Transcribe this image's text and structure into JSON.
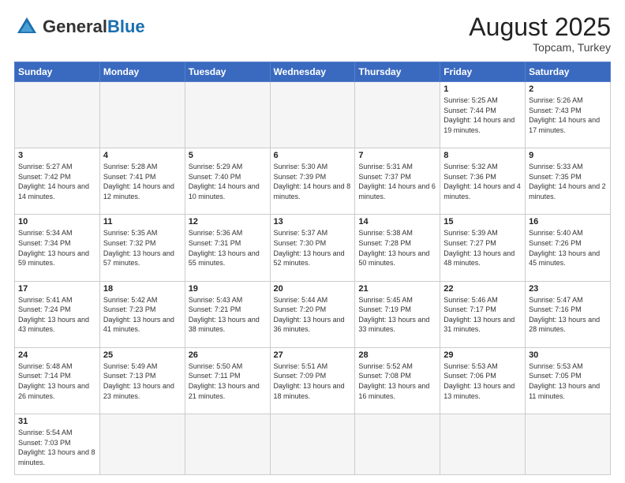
{
  "header": {
    "logo_general": "General",
    "logo_blue": "Blue",
    "title": "August 2025",
    "location": "Topcam, Turkey"
  },
  "weekdays": [
    "Sunday",
    "Monday",
    "Tuesday",
    "Wednesday",
    "Thursday",
    "Friday",
    "Saturday"
  ],
  "weeks": [
    [
      {
        "day": "",
        "info": ""
      },
      {
        "day": "",
        "info": ""
      },
      {
        "day": "",
        "info": ""
      },
      {
        "day": "",
        "info": ""
      },
      {
        "day": "",
        "info": ""
      },
      {
        "day": "1",
        "info": "Sunrise: 5:25 AM\nSunset: 7:44 PM\nDaylight: 14 hours and 19 minutes."
      },
      {
        "day": "2",
        "info": "Sunrise: 5:26 AM\nSunset: 7:43 PM\nDaylight: 14 hours and 17 minutes."
      }
    ],
    [
      {
        "day": "3",
        "info": "Sunrise: 5:27 AM\nSunset: 7:42 PM\nDaylight: 14 hours and 14 minutes."
      },
      {
        "day": "4",
        "info": "Sunrise: 5:28 AM\nSunset: 7:41 PM\nDaylight: 14 hours and 12 minutes."
      },
      {
        "day": "5",
        "info": "Sunrise: 5:29 AM\nSunset: 7:40 PM\nDaylight: 14 hours and 10 minutes."
      },
      {
        "day": "6",
        "info": "Sunrise: 5:30 AM\nSunset: 7:39 PM\nDaylight: 14 hours and 8 minutes."
      },
      {
        "day": "7",
        "info": "Sunrise: 5:31 AM\nSunset: 7:37 PM\nDaylight: 14 hours and 6 minutes."
      },
      {
        "day": "8",
        "info": "Sunrise: 5:32 AM\nSunset: 7:36 PM\nDaylight: 14 hours and 4 minutes."
      },
      {
        "day": "9",
        "info": "Sunrise: 5:33 AM\nSunset: 7:35 PM\nDaylight: 14 hours and 2 minutes."
      }
    ],
    [
      {
        "day": "10",
        "info": "Sunrise: 5:34 AM\nSunset: 7:34 PM\nDaylight: 13 hours and 59 minutes."
      },
      {
        "day": "11",
        "info": "Sunrise: 5:35 AM\nSunset: 7:32 PM\nDaylight: 13 hours and 57 minutes."
      },
      {
        "day": "12",
        "info": "Sunrise: 5:36 AM\nSunset: 7:31 PM\nDaylight: 13 hours and 55 minutes."
      },
      {
        "day": "13",
        "info": "Sunrise: 5:37 AM\nSunset: 7:30 PM\nDaylight: 13 hours and 52 minutes."
      },
      {
        "day": "14",
        "info": "Sunrise: 5:38 AM\nSunset: 7:28 PM\nDaylight: 13 hours and 50 minutes."
      },
      {
        "day": "15",
        "info": "Sunrise: 5:39 AM\nSunset: 7:27 PM\nDaylight: 13 hours and 48 minutes."
      },
      {
        "day": "16",
        "info": "Sunrise: 5:40 AM\nSunset: 7:26 PM\nDaylight: 13 hours and 45 minutes."
      }
    ],
    [
      {
        "day": "17",
        "info": "Sunrise: 5:41 AM\nSunset: 7:24 PM\nDaylight: 13 hours and 43 minutes."
      },
      {
        "day": "18",
        "info": "Sunrise: 5:42 AM\nSunset: 7:23 PM\nDaylight: 13 hours and 41 minutes."
      },
      {
        "day": "19",
        "info": "Sunrise: 5:43 AM\nSunset: 7:21 PM\nDaylight: 13 hours and 38 minutes."
      },
      {
        "day": "20",
        "info": "Sunrise: 5:44 AM\nSunset: 7:20 PM\nDaylight: 13 hours and 36 minutes."
      },
      {
        "day": "21",
        "info": "Sunrise: 5:45 AM\nSunset: 7:19 PM\nDaylight: 13 hours and 33 minutes."
      },
      {
        "day": "22",
        "info": "Sunrise: 5:46 AM\nSunset: 7:17 PM\nDaylight: 13 hours and 31 minutes."
      },
      {
        "day": "23",
        "info": "Sunrise: 5:47 AM\nSunset: 7:16 PM\nDaylight: 13 hours and 28 minutes."
      }
    ],
    [
      {
        "day": "24",
        "info": "Sunrise: 5:48 AM\nSunset: 7:14 PM\nDaylight: 13 hours and 26 minutes."
      },
      {
        "day": "25",
        "info": "Sunrise: 5:49 AM\nSunset: 7:13 PM\nDaylight: 13 hours and 23 minutes."
      },
      {
        "day": "26",
        "info": "Sunrise: 5:50 AM\nSunset: 7:11 PM\nDaylight: 13 hours and 21 minutes."
      },
      {
        "day": "27",
        "info": "Sunrise: 5:51 AM\nSunset: 7:09 PM\nDaylight: 13 hours and 18 minutes."
      },
      {
        "day": "28",
        "info": "Sunrise: 5:52 AM\nSunset: 7:08 PM\nDaylight: 13 hours and 16 minutes."
      },
      {
        "day": "29",
        "info": "Sunrise: 5:53 AM\nSunset: 7:06 PM\nDaylight: 13 hours and 13 minutes."
      },
      {
        "day": "30",
        "info": "Sunrise: 5:53 AM\nSunset: 7:05 PM\nDaylight: 13 hours and 11 minutes."
      }
    ],
    [
      {
        "day": "31",
        "info": "Sunrise: 5:54 AM\nSunset: 7:03 PM\nDaylight: 13 hours and 8 minutes."
      },
      {
        "day": "",
        "info": ""
      },
      {
        "day": "",
        "info": ""
      },
      {
        "day": "",
        "info": ""
      },
      {
        "day": "",
        "info": ""
      },
      {
        "day": "",
        "info": ""
      },
      {
        "day": "",
        "info": ""
      }
    ]
  ]
}
